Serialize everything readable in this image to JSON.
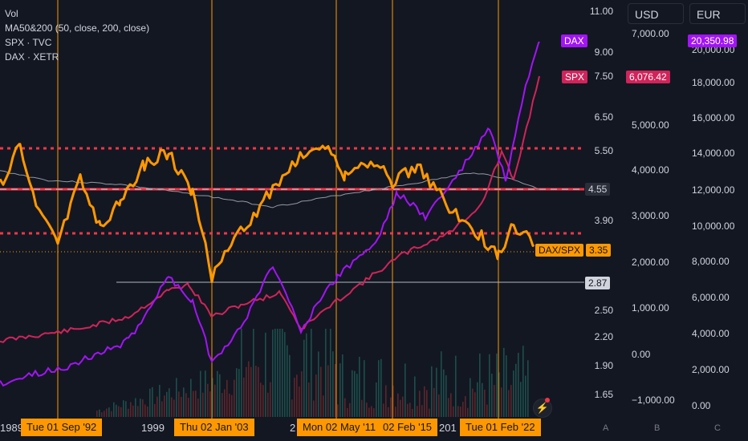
{
  "legend": {
    "vol": "Vol",
    "ma": "MA50&200 (50, close, 200, close)",
    "spx": "SPX · TVC",
    "dax": "DAX · XETR"
  },
  "header": {
    "usd": "USD",
    "eur": "EUR"
  },
  "ratio_axis": {
    "ticks": [
      "11.00",
      "9.00",
      "7.50",
      "6.50",
      "5.50",
      "4.55",
      "3.90",
      "3.35",
      "2.87",
      "2.50",
      "2.20",
      "1.90",
      "1.65"
    ],
    "current_label": "4.55",
    "last_label": "3.35",
    "line_label": "2.87",
    "series_tag": "DAX/SPX"
  },
  "usd_axis": {
    "ticks": [
      "7,000.00",
      "5,000.00",
      "4,000.00",
      "3,000.00",
      "2,000.00",
      "1,000.00",
      "0.00",
      "−1,000.00"
    ],
    "spx_price": "6,076.42",
    "spx_tag": "SPX"
  },
  "eur_axis": {
    "ticks": [
      "20,000.00",
      "18,000.00",
      "16,000.00",
      "14,000.00",
      "12,000.00",
      "10,000.00",
      "8,000.00",
      "6,000.00",
      "4,000.00",
      "2,000.00",
      "0.00"
    ],
    "dax_price": "20,350.98",
    "dax_tag": "DAX"
  },
  "time_axis": {
    "plain": [
      "1989",
      "1999",
      "2",
      "201"
    ],
    "tags": [
      "Tue 01 Sep '92",
      "Thu 02 Jan '03",
      "Mon 02 May '11",
      "02 Feb '15",
      "Tue 01 Feb '22"
    ]
  },
  "scale_letters": [
    "A",
    "B",
    "C"
  ],
  "colors": {
    "ratio": "#ff9800",
    "spx": "#d0245a",
    "dax": "#a314f5",
    "hline": "#f23645",
    "ma": "#9598a1",
    "vline": "#ff9800"
  }
}
